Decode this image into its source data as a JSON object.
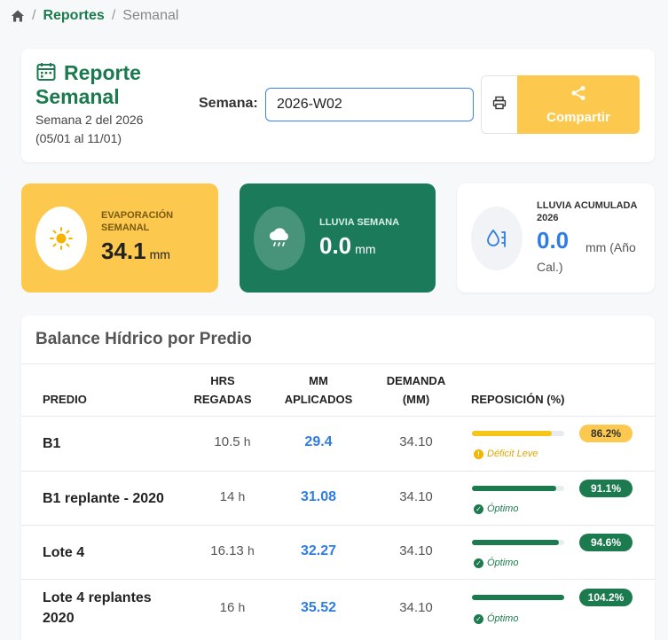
{
  "breadcrumb": {
    "home_icon": "home-icon",
    "items": [
      "Reportes",
      "Semanal"
    ]
  },
  "header": {
    "title": "Reporte Semanal",
    "subtitle": "Semana 2 del 2026 (05/01 al 11/01)",
    "week_label": "Semana:",
    "week_value": "2026-W02",
    "share_label": "Compartir",
    "share_color": "#fcc94e"
  },
  "stats": {
    "evap": {
      "label": "EVAPORACIÓN SEMANAL",
      "value": "34.1",
      "unit": "mm"
    },
    "rain": {
      "label": "LLUVIA SEMANA",
      "value": "0.0",
      "unit": "mm"
    },
    "acc": {
      "label": "LLUVIA ACUMULADA 2026",
      "value": "0.0",
      "unit": "mm (Año",
      "unit2": "Cal.)"
    }
  },
  "table": {
    "title": "Balance Hídrico por Predio",
    "headers": [
      "PREDIO",
      "HRS REGADAS",
      "MM APLICADOS",
      "DEMANDA (MM)",
      "REPOSICIÓN (%)"
    ],
    "rows": [
      {
        "predio": "B1",
        "hrs": "10.5",
        "hrs_unit": "h",
        "mm": "29.4",
        "demanda": "34.10",
        "pct": "86.2%",
        "fill": 0.862,
        "status": "Déficit Leve",
        "status_type": "warning"
      },
      {
        "predio": "B1 replante - 2020",
        "hrs": "14",
        "hrs_unit": "h",
        "mm": "31.08",
        "demanda": "34.10",
        "pct": "91.1%",
        "fill": 0.911,
        "status": "Óptimo",
        "status_type": "ok"
      },
      {
        "predio": "Lote 4",
        "hrs": "16.13",
        "hrs_unit": "h",
        "mm": "32.27",
        "demanda": "34.10",
        "pct": "94.6%",
        "fill": 0.946,
        "status": "Óptimo",
        "status_type": "ok"
      },
      {
        "predio": "Lote 4 replantes 2020",
        "hrs": "16",
        "hrs_unit": "h",
        "mm": "35.52",
        "demanda": "34.10",
        "pct": "104.2%",
        "fill": 1.0,
        "status": "Óptimo",
        "status_type": "ok"
      }
    ]
  },
  "colors": {
    "green": "#1b7a4e",
    "warning": "#f5c518",
    "ok": "#1b7a4e",
    "blue": "#2f7de1"
  }
}
